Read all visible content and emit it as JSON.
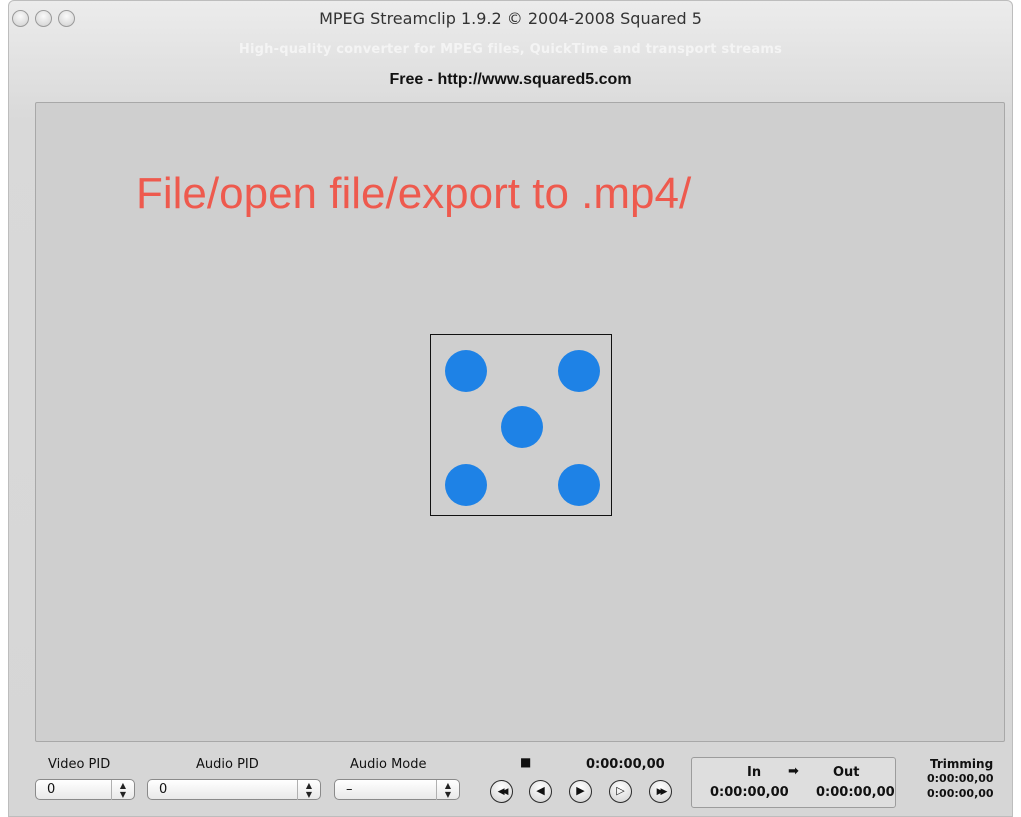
{
  "window": {
    "title": "MPEG Streamclip 1.9.2 © 2004-2008 Squared 5",
    "subtitle": "High-quality converter for MPEG files, QuickTime and transport streams",
    "url_line": "Free  -  http://www.squared5.com"
  },
  "viewer": {
    "instruction": "File/open file/export to .mp4/",
    "placeholder_icon": "dice-five-icon",
    "pip_color": "#1e82e6",
    "instruction_color": "#ee5a4e"
  },
  "controls": {
    "video_pid": {
      "label": "Video PID",
      "value": "0"
    },
    "audio_pid": {
      "label": "Audio PID",
      "value": "0"
    },
    "audio_mode": {
      "label": "Audio Mode",
      "value": "–"
    },
    "stop_glyph": "■",
    "timecode": "0:00:00,00",
    "transport": {
      "rewind": "◀◀",
      "step_back": "◀",
      "play": "▶",
      "step_forward": "▷",
      "fast_forward": "▶▶"
    },
    "in_label": "In",
    "arrow": "➡",
    "out_label": "Out",
    "in_time": "0:00:00,00",
    "out_time": "0:00:00,00",
    "trimming": {
      "label": "Trimming",
      "line1": "0:00:00,00",
      "line2": "0:00:00,00"
    }
  }
}
